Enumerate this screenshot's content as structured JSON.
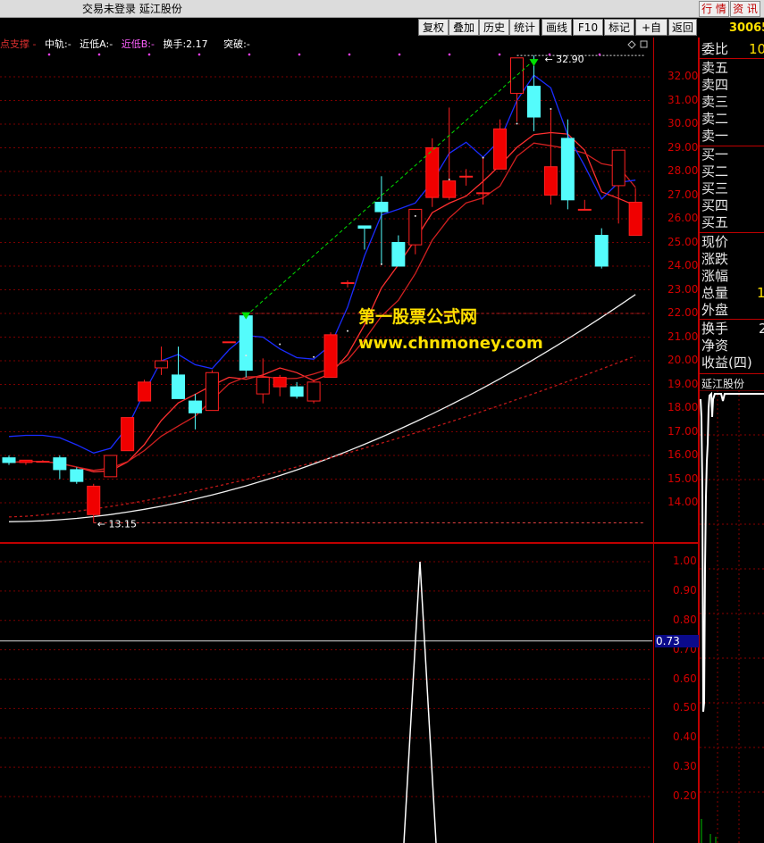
{
  "window": {
    "title": "交易未登录  延江股份",
    "buttons": [
      "行 情",
      "资 讯"
    ]
  },
  "toolbar": {
    "items": [
      "复权",
      "叠加",
      "历史",
      "统计",
      "画线",
      "F10",
      "标记",
      "+自选",
      "返回"
    ]
  },
  "indicator_line": {
    "name": "点支撑",
    "mid_label": "中轨:",
    "mid_value": "-",
    "low_a_label": "近低A:",
    "low_a_value": "-",
    "low_b_label": "近低B:",
    "low_b_value": "-",
    "turnover_label": "换手:",
    "turnover_value": "2.17",
    "breakout_label": "突破:",
    "breakout_value": "-"
  },
  "price_axis": [
    "32.00",
    "31.00",
    "30.00",
    "29.00",
    "28.00",
    "27.00",
    "26.00",
    "25.00",
    "24.00",
    "23.00",
    "22.00",
    "21.00",
    "20.00",
    "19.00",
    "18.00",
    "17.00",
    "16.00",
    "15.00",
    "14.00"
  ],
  "lower_axis": [
    "1.00",
    "0.90",
    "0.80",
    "0.70",
    "0.60",
    "0.50",
    "0.40",
    "0.30",
    "0.20"
  ],
  "lower_current_value": "0.73",
  "annotations": {
    "high": "32.90",
    "low": "13.15"
  },
  "watermark": {
    "line1": "第一股票公式网",
    "line2": "www.chnmoney.com"
  },
  "right_panel": {
    "code": "30065",
    "weibi_label": "委比",
    "weibi_value": "10",
    "sell_levels": [
      "卖五",
      "卖四",
      "卖三",
      "卖二",
      "卖一"
    ],
    "buy_levels": [
      "买一",
      "买二",
      "买三",
      "买四",
      "买五"
    ],
    "stats": [
      "现价",
      "涨跌",
      "涨幅",
      "总量",
      "外盘"
    ],
    "total_value": "1",
    "stats2": [
      "换手",
      "净资",
      "收益(四)"
    ],
    "turnover_value": "2",
    "mini_chart_title": "延江股份"
  },
  "chart_data": {
    "type": "candlestick",
    "y_range": [
      13,
      33
    ],
    "candles": [
      {
        "o": 15.9,
        "h": 16.0,
        "l": 15.6,
        "c": 15.7
      },
      {
        "o": 15.7,
        "h": 15.8,
        "l": 15.6,
        "c": 15.8
      },
      {
        "o": 15.75,
        "h": 15.8,
        "l": 15.7,
        "c": 15.75
      },
      {
        "o": 15.9,
        "h": 16.0,
        "l": 15.0,
        "c": 15.4
      },
      {
        "o": 15.4,
        "h": 15.5,
        "l": 14.8,
        "c": 14.9
      },
      {
        "o": 13.5,
        "h": 14.8,
        "l": 13.15,
        "c": 14.7
      },
      {
        "o": 15.1,
        "h": 16.0,
        "l": 15.1,
        "c": 16.0
      },
      {
        "o": 16.2,
        "h": 17.6,
        "l": 16.2,
        "c": 17.6
      },
      {
        "o": 18.3,
        "h": 19.2,
        "l": 18.3,
        "c": 19.1
      },
      {
        "o": 19.7,
        "h": 20.6,
        "l": 19.4,
        "c": 20.0
      },
      {
        "o": 19.4,
        "h": 20.6,
        "l": 18.5,
        "c": 18.4
      },
      {
        "o": 18.3,
        "h": 18.6,
        "l": 17.1,
        "c": 17.8
      },
      {
        "o": 17.9,
        "h": 19.6,
        "l": 17.9,
        "c": 19.5
      },
      {
        "o": 20.8,
        "h": 20.8,
        "l": 20.8,
        "c": 20.8
      },
      {
        "o": 21.9,
        "h": 21.9,
        "l": 19.3,
        "c": 19.6
      },
      {
        "o": 18.6,
        "h": 20.1,
        "l": 18.2,
        "c": 19.3
      },
      {
        "o": 18.9,
        "h": 19.4,
        "l": 18.5,
        "c": 19.3
      },
      {
        "o": 18.9,
        "h": 19.1,
        "l": 18.4,
        "c": 18.5
      },
      {
        "o": 18.3,
        "h": 19.2,
        "l": 18.2,
        "c": 19.1
      },
      {
        "o": 19.3,
        "h": 21.2,
        "l": 19.3,
        "c": 21.1
      },
      {
        "o": 23.3,
        "h": 23.4,
        "l": 23.1,
        "c": 23.3
      },
      {
        "o": 25.7,
        "h": 25.7,
        "l": 24.7,
        "c": 25.6
      },
      {
        "o": 26.7,
        "h": 27.8,
        "l": 24.1,
        "c": 26.3
      },
      {
        "o": 25.0,
        "h": 25.3,
        "l": 24.1,
        "c": 24.0
      },
      {
        "o": 24.9,
        "h": 26.3,
        "l": 24.5,
        "c": 26.4
      },
      {
        "o": 26.9,
        "h": 29.4,
        "l": 26.5,
        "c": 29.0
      },
      {
        "o": 26.9,
        "h": 30.7,
        "l": 26.8,
        "c": 27.6
      },
      {
        "o": 27.8,
        "h": 28.1,
        "l": 27.4,
        "c": 27.8
      },
      {
        "o": 27.1,
        "h": 28.6,
        "l": 26.6,
        "c": 27.1
      },
      {
        "o": 28.1,
        "h": 30.2,
        "l": 28.1,
        "c": 29.8
      },
      {
        "o": 31.3,
        "h": 32.8,
        "l": 30.1,
        "c": 32.8
      },
      {
        "o": 31.6,
        "h": 32.9,
        "l": 29.7,
        "c": 30.3
      },
      {
        "o": 27.0,
        "h": 30.6,
        "l": 26.6,
        "c": 28.2
      },
      {
        "o": 29.4,
        "h": 30.2,
        "l": 26.4,
        "c": 26.8
      },
      {
        "o": 26.4,
        "h": 26.8,
        "l": 26.4,
        "c": 26.4
      },
      {
        "o": 25.3,
        "h": 25.6,
        "l": 23.9,
        "c": 24.0
      },
      {
        "o": 27.4,
        "h": 28.9,
        "l": 25.8,
        "c": 28.9
      },
      {
        "o": 25.3,
        "h": 27.3,
        "l": 25.3,
        "c": 26.7
      }
    ]
  }
}
